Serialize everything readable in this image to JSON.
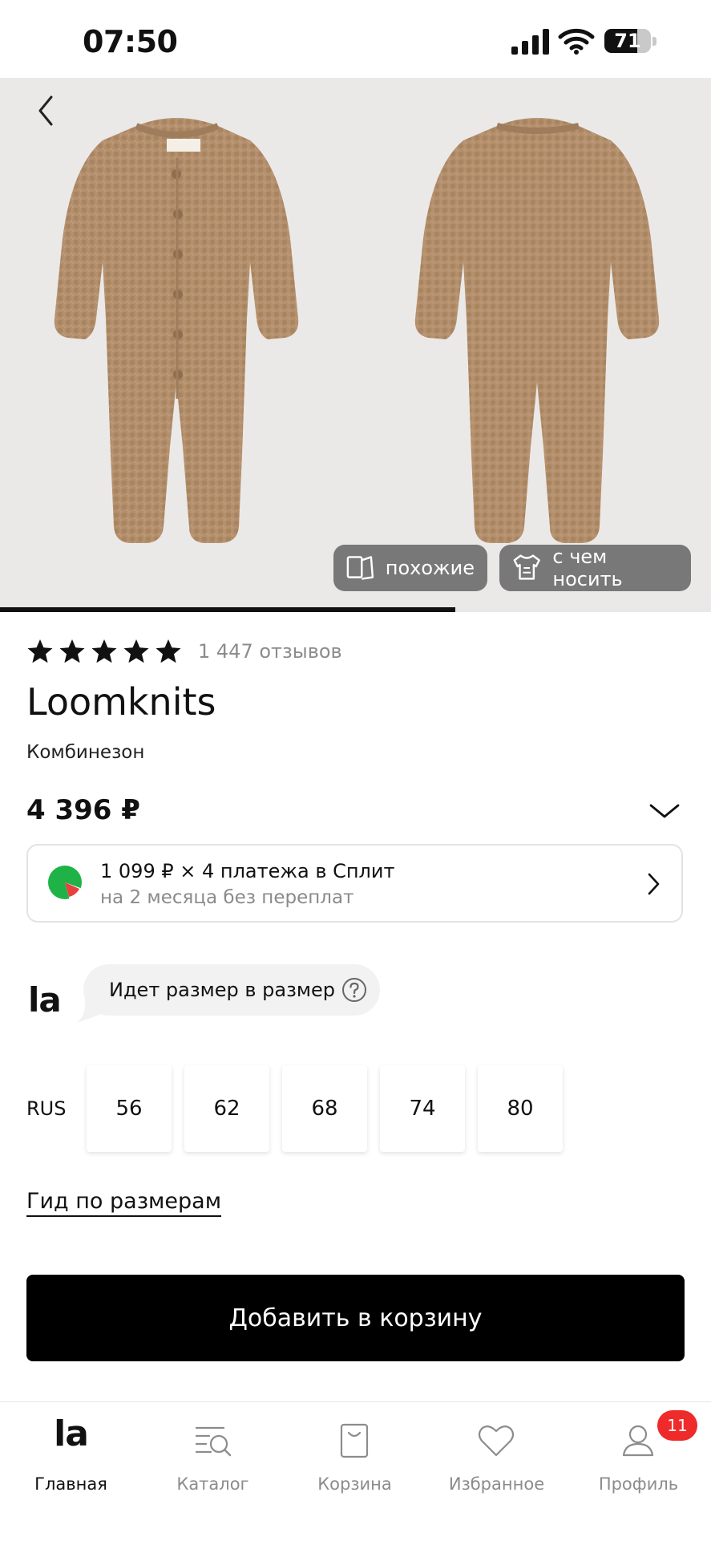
{
  "status_bar": {
    "time": "07:50",
    "battery": "71",
    "battery_level": 0.71
  },
  "gallery": {
    "chips": {
      "similar": "похожие",
      "outfit": "с чем носить"
    },
    "progress": 0.64
  },
  "product": {
    "rating_stars": 5,
    "reviews": "1 447 отзывов",
    "brand": "Loomknits",
    "category": "Комбинезон",
    "price": "4 396 ₽"
  },
  "split": {
    "title": "1 099 ₽ × 4 платежа в Сплит",
    "subtitle": "на 2 месяца без переплат"
  },
  "fit": {
    "logo": "la",
    "text": "Идет размер в размер"
  },
  "sizes": {
    "system": "RUS",
    "options": [
      "56",
      "62",
      "68",
      "74",
      "80"
    ]
  },
  "size_guide": "Гид по размерам",
  "add_to_cart": "Добавить в корзину",
  "nav": {
    "home": "Главная",
    "home_logo": "la",
    "catalog": "Каталог",
    "cart": "Корзина",
    "favorites": "Избранное",
    "profile": "Профиль",
    "profile_badge": "11"
  },
  "colors": {
    "accent": "#000000",
    "badge": "#ef2a2a",
    "knit": "#b4906e"
  }
}
